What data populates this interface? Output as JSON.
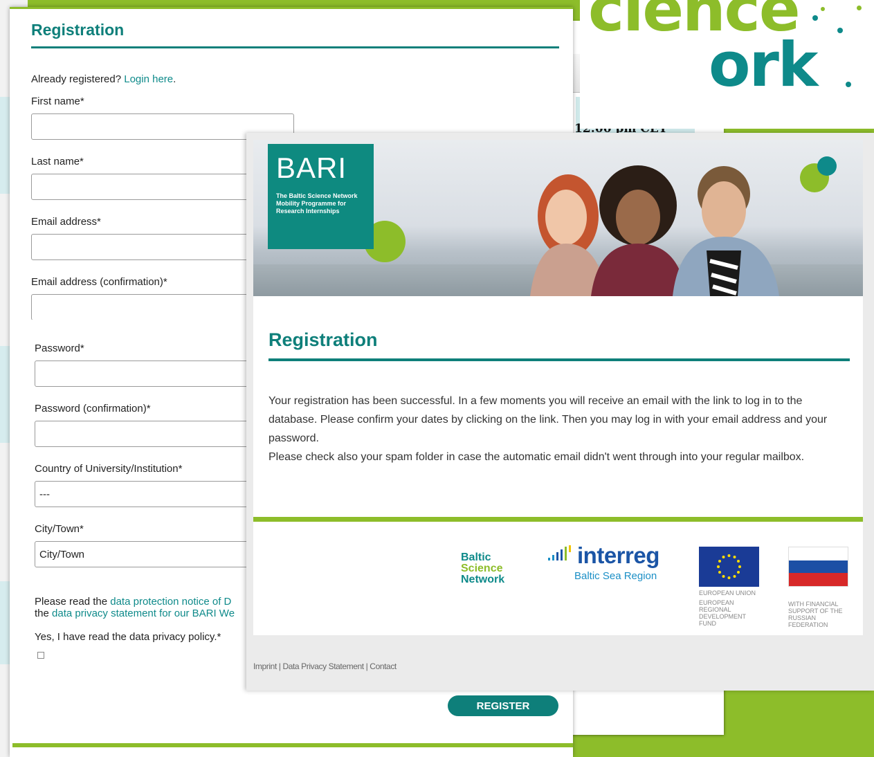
{
  "form": {
    "title": "Registration",
    "already_text": "Already registered?",
    "login_link": "Login here",
    "fields": [
      {
        "label": "First name*",
        "value": ""
      },
      {
        "label": "Last name*",
        "value": ""
      },
      {
        "label": "Email address*",
        "value": ""
      },
      {
        "label": "Email address (confirmation)*",
        "value": ""
      },
      {
        "label": "Password*",
        "value": ""
      },
      {
        "label": "Password (confirmation)*",
        "value": ""
      },
      {
        "label": "Country of University/Institution*",
        "value": "---"
      },
      {
        "label": "City/Town*",
        "placeholder": "City/Town"
      }
    ],
    "privacy_prefix": "Please read the",
    "privacy_link1": "data protection notice of D",
    "privacy_mid": "the",
    "privacy_link2": "data privacy statement for our BARI We",
    "privacy_consent": "Yes, I have read the data privacy policy.*",
    "register_label": "REGISTER"
  },
  "background": {
    "time_text": "12:00 pm CET",
    "logo_word1": "cience",
    "logo_word2": "ork"
  },
  "success": {
    "bari_title": "BARI",
    "bari_subtitle": "The Baltic Science Network Mobility Programme for Research Internships",
    "title": "Registration",
    "message_1": "Your registration has been successful. In a few moments you will receive an email with the link to log in to the database. Please confirm your dates by clicking on the link. Then you may log in with your email address and your password.",
    "message_2": "Please check also your spam folder in case the automatic email didn't went through into your regular mailbox.",
    "logos": {
      "bsn_1": "Baltic",
      "bsn_2": "Science",
      "bsn_3": "Network",
      "interreg_name": "interreg",
      "interreg_sub": "Baltic Sea Region",
      "eu_label": "EUROPEAN UNION",
      "eu_fund": "EUROPEAN REGIONAL DEVELOPMENT FUND",
      "ru_fund": "WITH FINANCIAL SUPPORT OF THE RUSSIAN FEDERATION"
    },
    "footer": "Imprint | Data Privacy Statement | Contact"
  },
  "colors": {
    "teal": "#0e7f7a",
    "green": "#8dbd2a",
    "link": "#0e8a8a"
  }
}
